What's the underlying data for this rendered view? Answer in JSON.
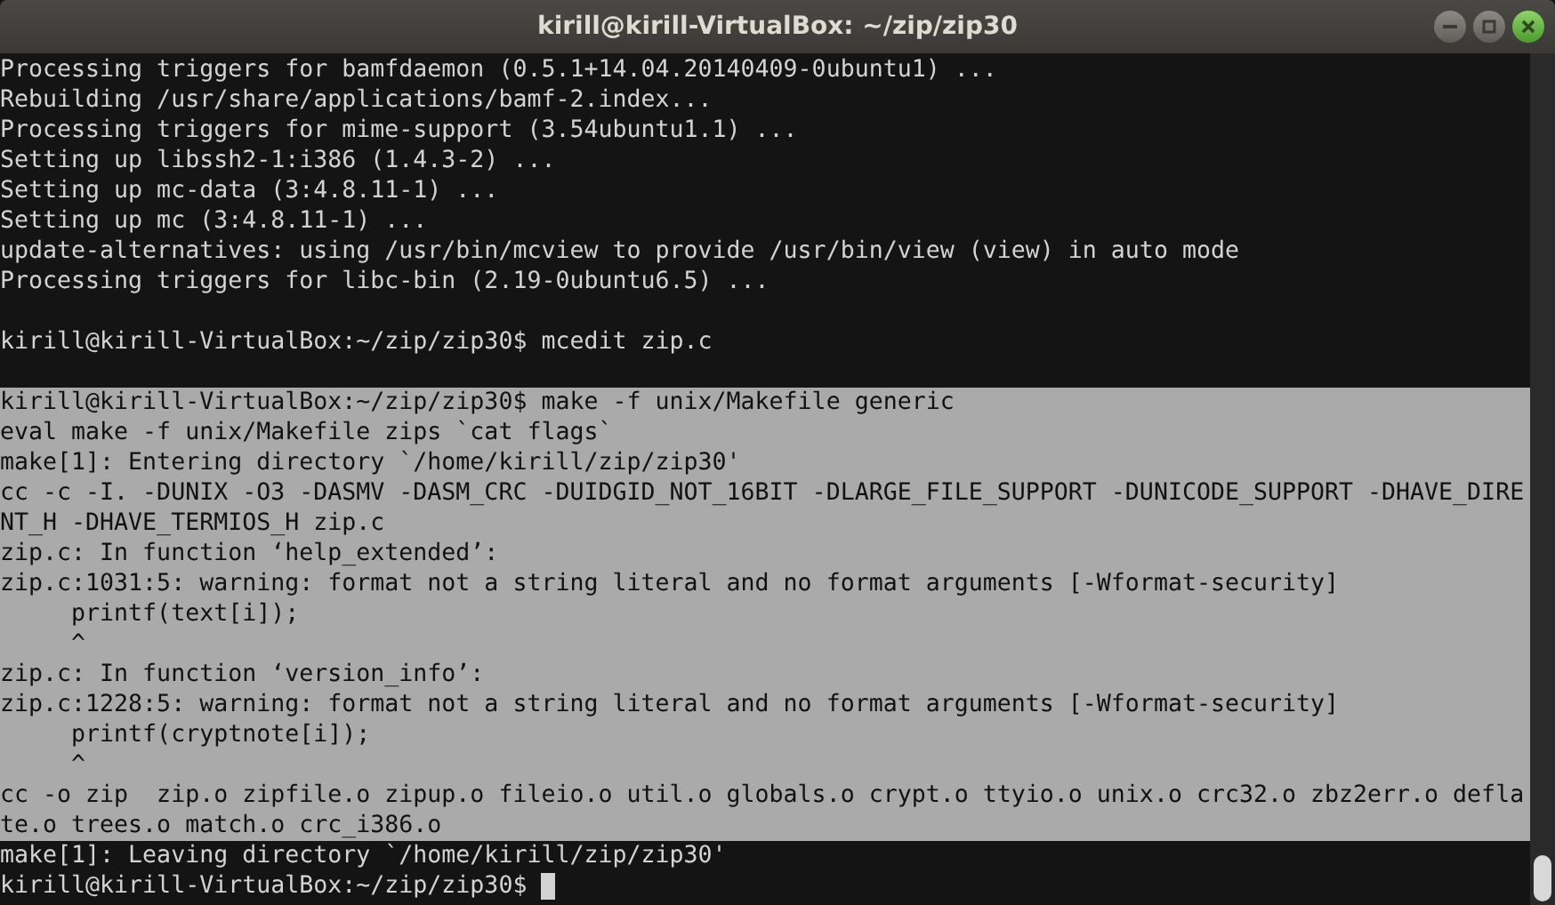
{
  "window": {
    "title": "kirill@kirill-VirtualBox: ~/zip/zip30"
  },
  "terminal": {
    "cursor_visible": true,
    "lines": [
      {
        "kind": "text",
        "text": "Processing triggers for bamfdaemon (0.5.1+14.04.20140409-0ubuntu1) ...",
        "selected": false
      },
      {
        "kind": "text",
        "text": "Rebuilding /usr/share/applications/bamf-2.index...",
        "selected": false
      },
      {
        "kind": "text",
        "text": "Processing triggers for mime-support (3.54ubuntu1.1) ...",
        "selected": false
      },
      {
        "kind": "text",
        "text": "Setting up libssh2-1:i386 (1.4.3-2) ...",
        "selected": false
      },
      {
        "kind": "text",
        "text": "Setting up mc-data (3:4.8.11-1) ...",
        "selected": false
      },
      {
        "kind": "text",
        "text": "Setting up mc (3:4.8.11-1) ...",
        "selected": false
      },
      {
        "kind": "text",
        "text": "update-alternatives: using /usr/bin/mcview to provide /usr/bin/view (view) in auto mode",
        "selected": false
      },
      {
        "kind": "text",
        "text": "Processing triggers for libc-bin (2.19-0ubuntu6.5) ...",
        "selected": false
      },
      {
        "kind": "blank",
        "selected": false
      },
      {
        "kind": "text",
        "text": "kirill@kirill-VirtualBox:~/zip/zip30$ mcedit zip.c",
        "selected": false
      },
      {
        "kind": "blank",
        "selected": false
      },
      {
        "kind": "text",
        "text": "kirill@kirill-VirtualBox:~/zip/zip30$ make -f unix/Makefile generic",
        "selected": true
      },
      {
        "kind": "text",
        "text": "eval make -f unix/Makefile zips `cat flags`",
        "selected": true
      },
      {
        "kind": "text",
        "text": "make[1]: Entering directory `/home/kirill/zip/zip30'",
        "selected": true
      },
      {
        "kind": "text",
        "text": "cc -c -I. -DUNIX -O3 -DASMV -DASM_CRC -DUIDGID_NOT_16BIT -DLARGE_FILE_SUPPORT -DUNICODE_SUPPORT -DHAVE_DIRE",
        "selected": true
      },
      {
        "kind": "text",
        "text": "NT_H -DHAVE_TERMIOS_H zip.c",
        "selected": true
      },
      {
        "kind": "text",
        "text": "zip.c: In function ‘help_extended’:",
        "selected": true
      },
      {
        "kind": "text",
        "text": "zip.c:1031:5: warning: format not a string literal and no format arguments [-Wformat-security]",
        "selected": true
      },
      {
        "kind": "text",
        "text": "     printf(text[i]);",
        "selected": true
      },
      {
        "kind": "text",
        "text": "     ^",
        "selected": true
      },
      {
        "kind": "text",
        "text": "zip.c: In function ‘version_info’:",
        "selected": true
      },
      {
        "kind": "text",
        "text": "zip.c:1228:5: warning: format not a string literal and no format arguments [-Wformat-security]",
        "selected": true
      },
      {
        "kind": "text",
        "text": "     printf(cryptnote[i]);",
        "selected": true
      },
      {
        "kind": "text",
        "text": "     ^",
        "selected": true
      },
      {
        "kind": "text",
        "text": "cc -o zip  zip.o zipfile.o zipup.o fileio.o util.o globals.o crypt.o ttyio.o unix.o crc32.o zbz2err.o defla",
        "selected": true
      },
      {
        "kind": "text",
        "text": "te.o trees.o match.o crc_i386.o",
        "selected": true
      },
      {
        "kind": "text",
        "text": "make[1]: Leaving directory `/home/kirill/zip/zip30'",
        "selected": false
      },
      {
        "kind": "text",
        "text": "kirill@kirill-VirtualBox:~/zip/zip30$",
        "selected": false
      }
    ]
  }
}
